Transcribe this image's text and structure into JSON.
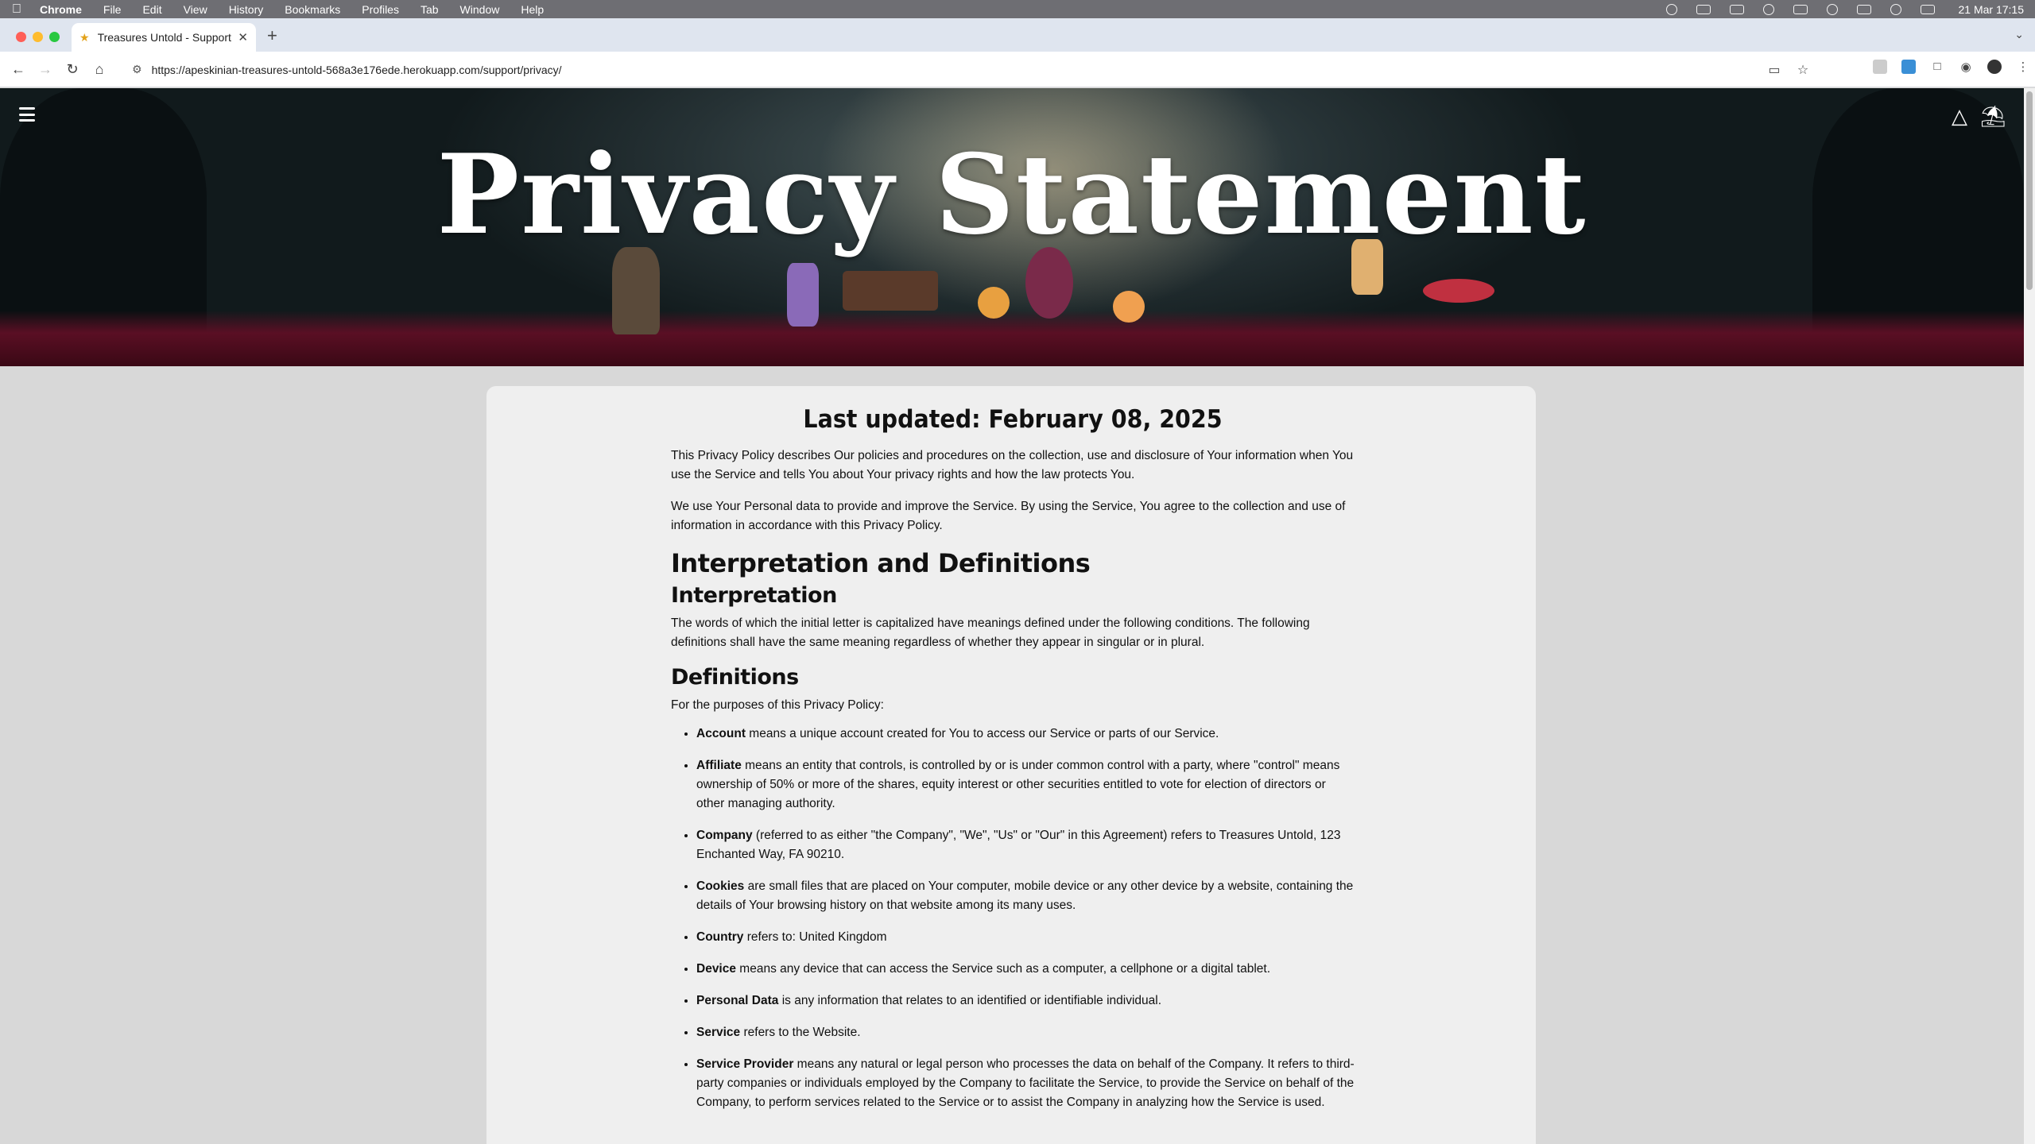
{
  "menubar": {
    "app": "Chrome",
    "items": [
      "File",
      "Edit",
      "View",
      "History",
      "Bookmarks",
      "Profiles",
      "Tab",
      "Window",
      "Help"
    ],
    "clock": "21 Mar  17:15"
  },
  "tab": {
    "title": "Treasures Untold - Support"
  },
  "toolbar": {
    "url": "https://apeskinian-treasures-untold-568a3e176ede.herokuapp.com/support/privacy/"
  },
  "hero": {
    "title": "Privacy Statement"
  },
  "content": {
    "updated": "Last updated: February 08, 2025",
    "intro": [
      "This Privacy Policy describes Our policies and procedures on the collection, use and disclosure of Your information when You use the Service and tells You about Your privacy rights and how the law protects You.",
      "We use Your Personal data to provide and improve the Service. By using the Service, You agree to the collection and use of information in accordance with this Privacy Policy."
    ],
    "h_interpretation_definitions": "Interpretation and Definitions",
    "h_interpretation": "Interpretation",
    "interpretation_text": "The words of which the initial letter is capitalized have meanings defined under the following conditions. The following definitions shall have the same meaning regardless of whether they appear in singular or in plural.",
    "h_definitions": "Definitions",
    "definitions_intro": "For the purposes of this Privacy Policy:",
    "definitions": [
      {
        "term": "Account",
        "text": " means a unique account created for You to access our Service or parts of our Service."
      },
      {
        "term": "Affiliate",
        "text": " means an entity that controls, is controlled by or is under common control with a party, where \"control\" means ownership of 50% or more of the shares, equity interest or other securities entitled to vote for election of directors or other managing authority."
      },
      {
        "term": "Company",
        "text": " (referred to as either \"the Company\", \"We\", \"Us\" or \"Our\" in this Agreement) refers to Treasures Untold, 123 Enchanted Way, FA 90210."
      },
      {
        "term": "Cookies",
        "text": " are small files that are placed on Your computer, mobile device or any other device by a website, containing the details of Your browsing history on that website among its many uses."
      },
      {
        "term": "Country",
        "text": " refers to: United Kingdom"
      },
      {
        "term": "Device",
        "text": " means any device that can access the Service such as a computer, a cellphone or a digital tablet."
      },
      {
        "term": "Personal Data",
        "text": " is any information that relates to an identified or identifiable individual."
      },
      {
        "term": "Service",
        "text": " refers to the Website."
      },
      {
        "term": "Service Provider",
        "text": " means any natural or legal person who processes the data on behalf of the Company. It refers to third-party companies or individuals employed by the Company to facilitate the Service, to provide the Service on behalf of the Company, to perform services related to the Service or to assist the Company in analyzing how the Service is used."
      }
    ]
  }
}
